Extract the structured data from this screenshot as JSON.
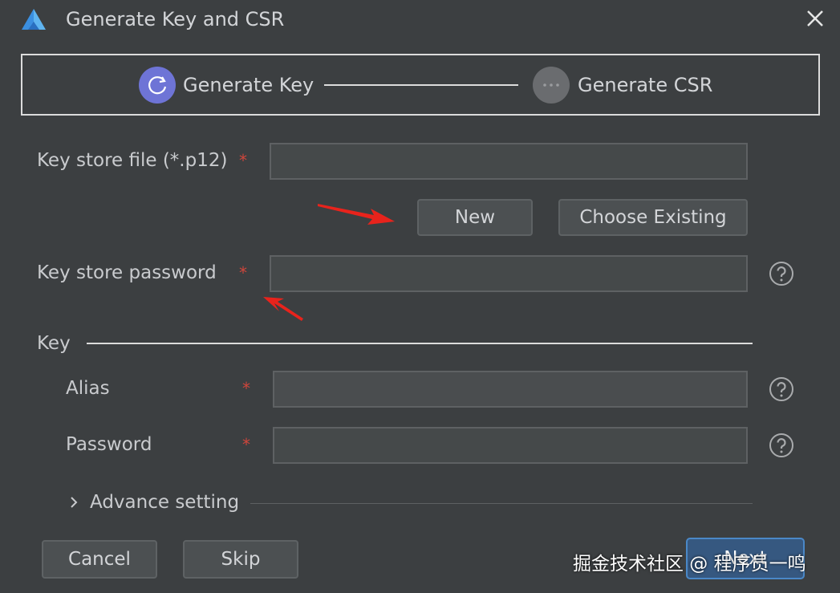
{
  "window": {
    "title": "Generate Key and CSR"
  },
  "steps": [
    {
      "label": "Generate Key",
      "state": "active"
    },
    {
      "label": "Generate CSR",
      "state": "pending"
    }
  ],
  "form": {
    "keystore_file": {
      "label": "Key store file (*.p12)",
      "required_mark": "*",
      "value": ""
    },
    "new_button": "New",
    "choose_existing_button": "Choose Existing",
    "keystore_password": {
      "label": "Key store password",
      "required_mark": "*",
      "value": ""
    },
    "key_section": "Key",
    "alias": {
      "label": "Alias",
      "required_mark": "*",
      "value": ""
    },
    "password": {
      "label": "Password",
      "required_mark": "*",
      "value": ""
    },
    "advance_setting": "Advance setting"
  },
  "footer": {
    "cancel": "Cancel",
    "skip": "Skip",
    "next": "Next"
  },
  "watermark": "掘金技术社区 @ 程序员一鸣",
  "colors": {
    "background": "#3c3f41",
    "accent": "#6e74d6",
    "required": "#d0463b",
    "annotation_arrow": "#e8231c",
    "primary_button": "#365880"
  },
  "icons": [
    "app-logo-icon",
    "close-icon",
    "refresh-icon",
    "more-dots-icon",
    "help-icon",
    "chevron-right-icon",
    "annotation-arrow"
  ]
}
